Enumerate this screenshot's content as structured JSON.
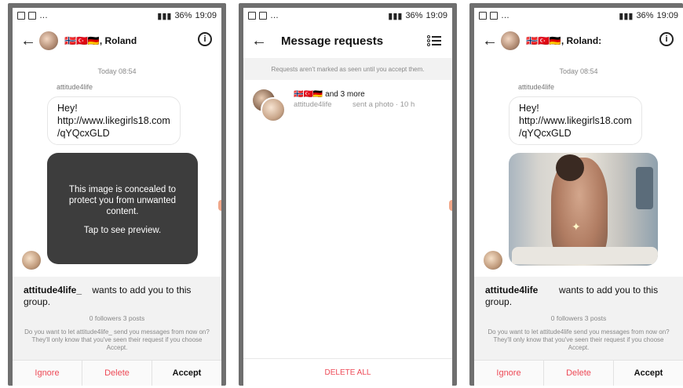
{
  "status": {
    "battery": "36%",
    "time": "19:09"
  },
  "screen1": {
    "title": "🇳🇴🇹🇷🇩🇪, Roland",
    "timestamp": "Today 08:54",
    "sender": "attitude4life",
    "message": "Hey!\nhttp://www.likegirls18.com\n/qYQcxGLD",
    "concealed_l1": "This image is concealed to protect you from unwanted content.",
    "concealed_l2": "Tap to see preview.",
    "request_user": "attitude4life_",
    "request_text": "wants to add you to this group.",
    "stats": "0 followers 3 posts",
    "description": "Do you want to let attitude4life_ send you messages from now on? They'll only know that you've seen their request if you choose Accept.",
    "ignore": "Ignore",
    "delete": "Delete",
    "accept": "Accept"
  },
  "screen2": {
    "title": "Message requests",
    "note": "Requests aren't marked as seen until you accept them.",
    "row_title": "🇳🇴🇹🇷🇩🇪 and 3 more",
    "row_sender": "attitude4life",
    "row_meta": "sent a photo · 10 h",
    "delete_all": "DELETE ALL"
  },
  "screen3": {
    "title": "🇳🇴🇹🇷🇩🇪, Roland:",
    "timestamp": "Today 08:54",
    "sender": "attitude4life",
    "message": "Hey!\nhttp://www.likegirls18.com\n/qYQcxGLD",
    "request_user": "attitude4life",
    "request_text": "wants to add you to this group.",
    "stats": "0 followers 3 posts",
    "description": "Do you want to let attitude4life send you messages from now on? They'll only know that you've seen their request if you choose Accept.",
    "ignore": "Ignore",
    "delete": "Delete",
    "accept": "Accept"
  },
  "icons": {
    "back": "arrow-left-icon",
    "info": "info-icon",
    "list": "list-settings-icon",
    "sparkle": "sparkle-icon"
  },
  "colors": {
    "danger": "#ed4956",
    "concealed_bg": "#3d3d3d",
    "panel_bg": "#f2f2f2"
  }
}
